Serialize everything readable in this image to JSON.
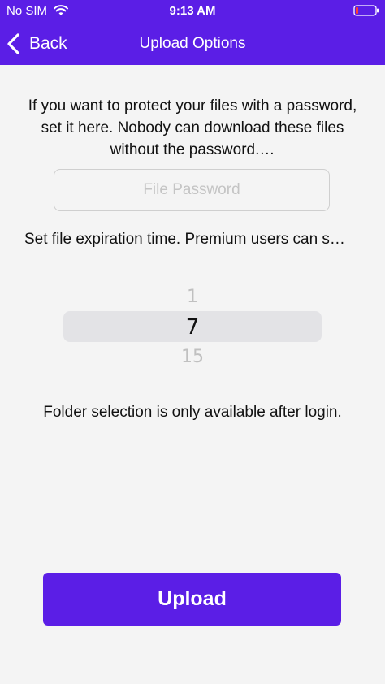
{
  "status_bar": {
    "carrier": "No SIM",
    "time": "9:13 AM",
    "wifi_icon": "wifi-icon",
    "battery_icon": "battery-icon"
  },
  "nav": {
    "back_label": "Back",
    "back_icon": "chevron-left-icon",
    "title": "Upload Options"
  },
  "password": {
    "info": "If you want to protect your files with a password, set it here. Nobody can download these files without the password.…",
    "placeholder": "File Password",
    "value": ""
  },
  "expiration": {
    "info": "Set file expiration time. Premium users can s…",
    "picker": {
      "previous": "1",
      "selected": "7",
      "next": "15"
    }
  },
  "folder": {
    "info": "Folder selection is only available after login."
  },
  "actions": {
    "upload_label": "Upload"
  },
  "colors": {
    "accent": "#5b1ee6",
    "background": "#f4f4f4",
    "picker_highlight": "#e3e3e6",
    "text": "#111111",
    "muted": "#c0c0c0"
  }
}
